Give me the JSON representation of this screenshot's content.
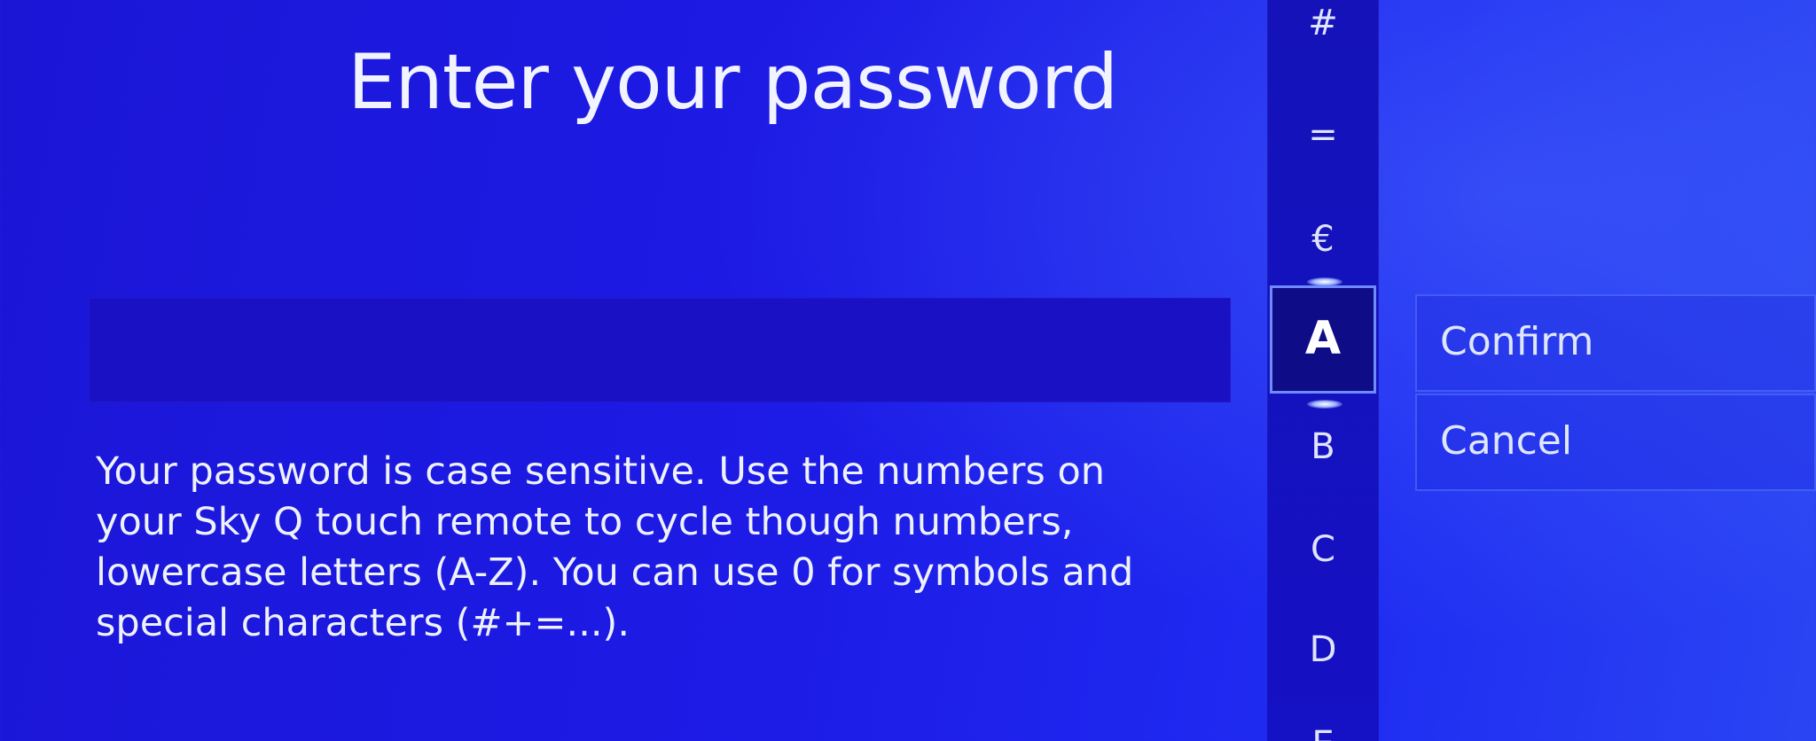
{
  "title": "Enter your password",
  "password_field": {
    "value": ""
  },
  "help_text": "Your password is case sensitive. Use the numbers on your Sky Q touch remote to cycle though numbers, lowercase letters (A-Z). You can use 0 for symbols and special characters (#+=...).",
  "keypad": {
    "keys_above": [
      "#",
      "=",
      "€"
    ],
    "selected": "A",
    "keys_below": [
      "B",
      "C",
      "D",
      "E"
    ]
  },
  "actions": {
    "confirm": "Confirm",
    "cancel": "Cancel"
  },
  "colors": {
    "background": "#1d1be6",
    "selected_key": "#0e0c86",
    "highlight": "#6f8bff"
  }
}
